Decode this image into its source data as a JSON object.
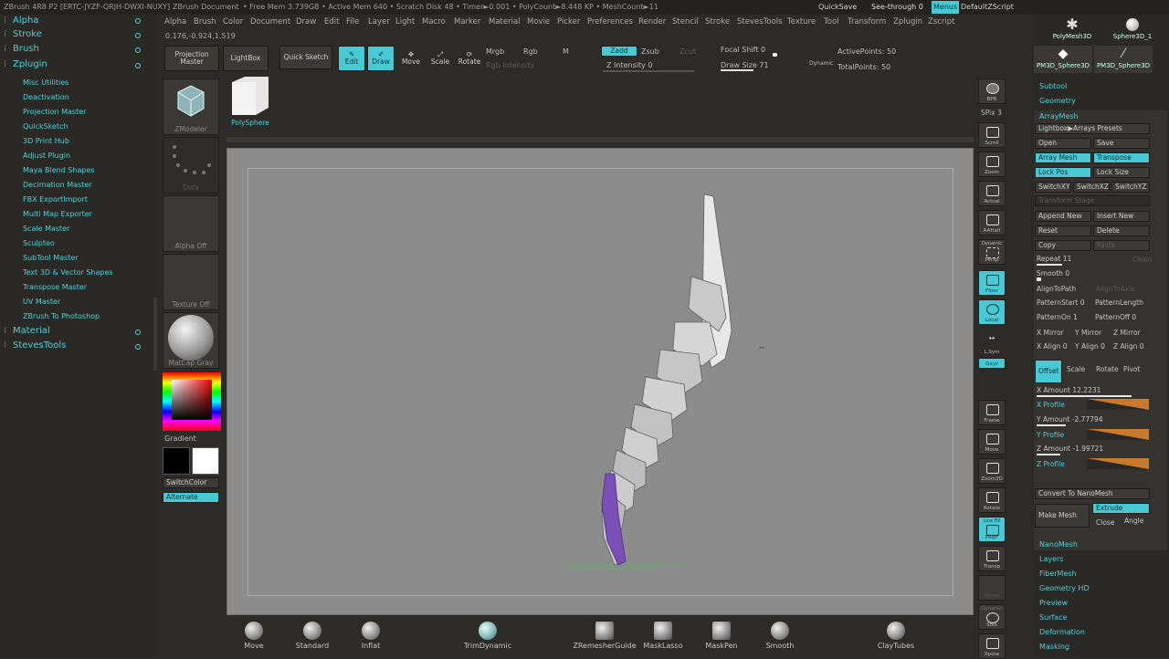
{
  "titlebar": {
    "app": "ZBrush 4R8 P2 [ERTC-JYZF-QRJH-DWXI-NUXY]",
    "doc": "ZBrush Document",
    "stats": "• Free Mem 3.739GB • Active Mem 640 • Scratch Disk 48 • Timer►0.001 • PolyCount►8.448 KP • MeshCount►11",
    "quicksave": "QuickSave",
    "seethrough": "See-through  0",
    "menus": "Menus",
    "script": "DefaultZScript"
  },
  "menubar": [
    "Alpha",
    "Brush",
    "Color",
    "Document",
    "Draw",
    "Edit",
    "File",
    "Layer",
    "Light",
    "Macro",
    "Marker",
    "Material",
    "Movie",
    "Picker",
    "Preferences",
    "Render",
    "Stencil",
    "Stroke",
    "StevesTools",
    "Texture",
    "Tool",
    "Transform",
    "Zplugin",
    "Zscript"
  ],
  "coords": "0.176,-0.924,1.519",
  "toolbar": {
    "projection": "Projection Master",
    "lightbox": "LightBox",
    "quicksketch": "Quick Sketch",
    "edit": "Edit",
    "draw": "Draw",
    "move": "Move",
    "scale": "Scale",
    "rotate": "Rotate",
    "mrgb": "Mrgb",
    "rgb": "Rgb",
    "m": "M",
    "rgb_intensity": "Rgb Intensity",
    "zadd": "Zadd",
    "zsub": "Zsub",
    "zcut": "Zcut",
    "z_intensity": "Z Intensity 0",
    "focal": "Focal Shift 0",
    "drawsize": "Draw Size 71",
    "dynamic": "Dynamic",
    "activepoints": "ActivePoints: 50",
    "totalpoints": "TotalPoints: 50"
  },
  "left": {
    "headers": [
      "Alpha",
      "Stroke",
      "Brush",
      "Zplugin"
    ],
    "items": [
      "Misc Utilities",
      "Deactivation",
      "Projection Master",
      "QuickSketch",
      "3D Print Hub",
      "Adjust Plugin",
      "Maya Blend Shapes",
      "Decimation Master",
      "FBX ExportImport",
      "Multi Map Exporter",
      "Scale Master",
      "Sculpteo",
      "SubTool Master",
      "Text 3D & Vector Shapes",
      "Transpose Master",
      "UV Master",
      "ZBrush To Photoshop"
    ],
    "footers": [
      "Material",
      "StevesTools"
    ]
  },
  "mid": {
    "zmodeler": "ZModeler",
    "polysphere": "PolySphere",
    "dots": "Dots",
    "alpha": "Alpha Off",
    "texture": "Texture Off",
    "matcap": "MatCap Gray",
    "gradient": "Gradient",
    "switchcolor": "SwitchColor",
    "alternate": "Alternate"
  },
  "tray": [
    "BPR",
    "SPix 3",
    "Scroll",
    "Zoom",
    "Actual",
    "AAHalf",
    "Persp",
    "Floor",
    "Local",
    "L.Sym",
    "Qxyz",
    "Frame",
    "Move",
    "Zoom3D",
    "Rotate",
    "PolyF",
    "Transp",
    "Ghost",
    "Solo",
    "Xpose",
    "Dynamic",
    "Line Fill"
  ],
  "right": {
    "thumbs": [
      "PolyMesh3D",
      "Sphere3D_1",
      "PM3D_Sphere3D",
      "PM3D_Sphere3D"
    ],
    "subtool": "Subtool",
    "geometry": "Geometry",
    "arraymesh": "ArrayMesh",
    "lightbox_arrays": "Lightbox▶Arrays Presets",
    "open": "Open",
    "save": "Save",
    "array_mesh": "Array Mesh",
    "transpose": "Transpose",
    "lockpos": "Lock Pos",
    "locksize": "Lock Size",
    "switchxy": "SwitchXY",
    "switchxz": "SwitchXZ",
    "switchyz": "SwitchYZ",
    "transformstage": "Transform Stage",
    "appendnew": "Append New",
    "insertnew": "Insert New",
    "reset": "Reset",
    "delete": "Delete",
    "copy": "Copy",
    "paste": "Paste",
    "repeat": "Repeat 11",
    "chain": "Chain",
    "smooth": "Smooth 0",
    "alignpath": "AlignToPath",
    "aligntoaxis": "AlignToAxis",
    "patternstart": "PatternStart 0",
    "patternlength": "PatternLength",
    "patternon": "PatternOn 1",
    "patternoff": "PatternOff 0",
    "xmirror": "X Mirror",
    "ymirror": "Y Mirror",
    "zmirror": "Z Mirror",
    "xalign": "X Align 0",
    "yalign": "Y Align 0",
    "zalign": "Z Align 0",
    "offset": "Offset",
    "scale": "Scale",
    "rotate": "Rotate",
    "pivot": "Pivot",
    "xamount": "X Amount 12.2231",
    "xprofile": "X Profile",
    "yamount": "Y Amount -2.77794",
    "yprofile": "Y Profile",
    "zamount": "Z Amount -1.99721",
    "zprofile": "Z Profile",
    "convert": "Convert To NanoMesh",
    "extrude": "Extrude",
    "makemesh": "Make Mesh",
    "close": "Close",
    "angle": "Angle",
    "sections": [
      "NanoMesh",
      "Layers",
      "FiberMesh",
      "Geometry HD",
      "Preview",
      "Surface",
      "Deformation",
      "Masking"
    ]
  },
  "bottom": [
    "Move",
    "Standard",
    "Inflat",
    "TrimDynamic",
    "ZRemesherGuide",
    "MaskLasso",
    "MaskPen",
    "Smooth",
    "ClayTubes"
  ],
  "colors": {
    "accent": "#49c9d4",
    "canvas": "#8c8c8c",
    "mesh": "#d9d9d9",
    "tip": "#7a4fb8"
  }
}
